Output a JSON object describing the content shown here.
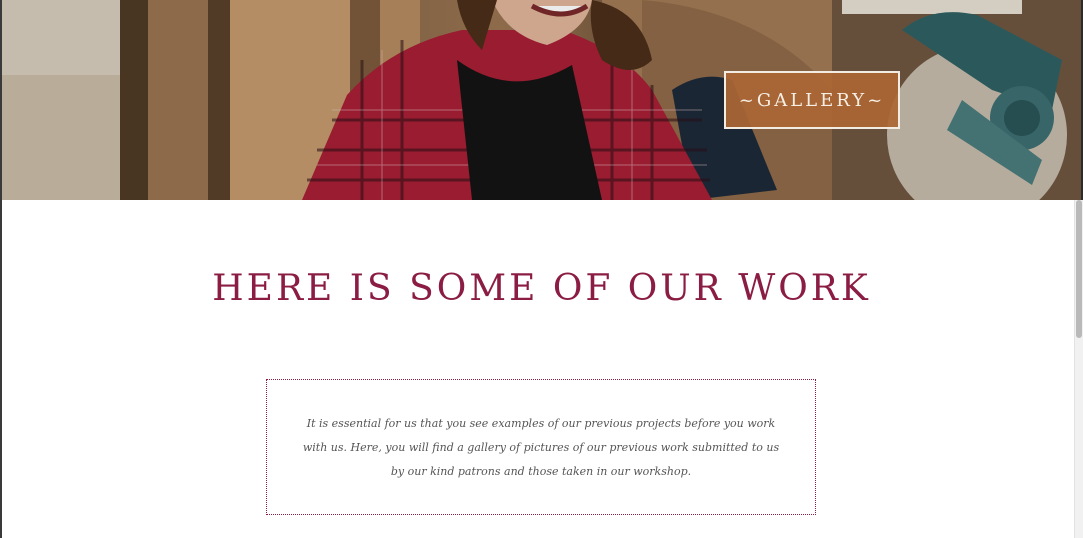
{
  "hero": {
    "badge_label": "~GALLERY~"
  },
  "main": {
    "heading": "HERE IS SOME OF OUR WORK",
    "intro_text": "It is essential for us that you see examples of our previous projects before you work with us. Here, you will find a gallery of pictures of our previous work submitted to us by our kind patrons and those taken in our workshop."
  },
  "colors": {
    "accent": "#8b1c43",
    "badge_bg": "#ab6634",
    "badge_text": "#f6efe5",
    "body_text": "#555555"
  }
}
